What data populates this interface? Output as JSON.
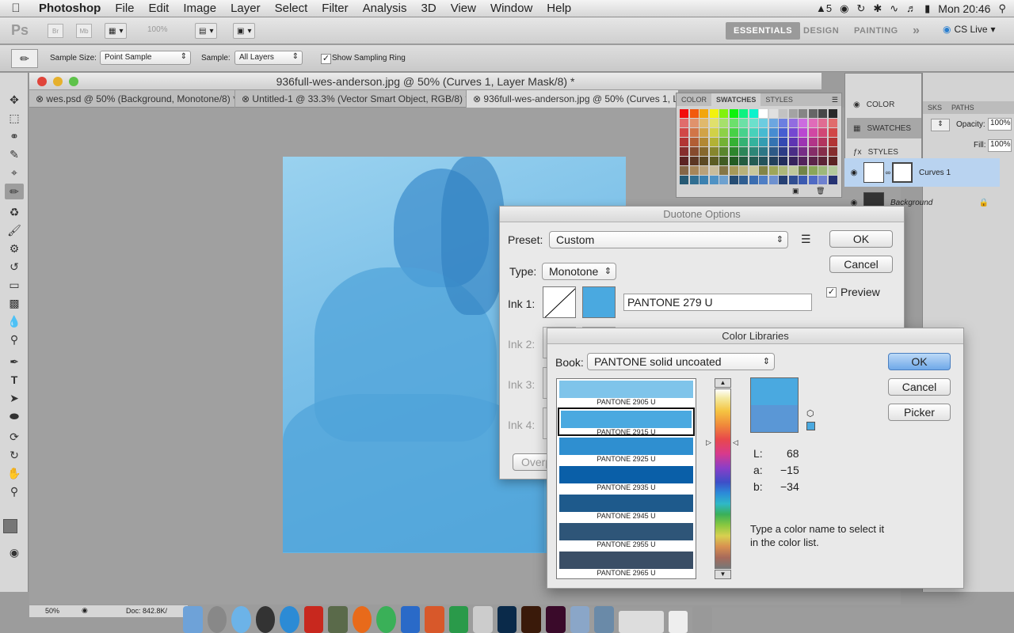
{
  "menubar": {
    "app_name": "Photoshop",
    "items": [
      "File",
      "Edit",
      "Image",
      "Layer",
      "Select",
      "Filter",
      "Analysis",
      "3D",
      "View",
      "Window",
      "Help"
    ],
    "clock": "Mon 20:46",
    "adobe_badge": "5"
  },
  "appbar": {
    "zoom": "100%",
    "workspaces": [
      "ESSENTIALS",
      "DESIGN",
      "PAINTING"
    ],
    "more": "»",
    "cslive": "CS Live"
  },
  "options": {
    "sample_size_label": "Sample Size:",
    "sample_size_value": "Point Sample",
    "sample_label": "Sample:",
    "sample_value": "All Layers",
    "ring_label": "Show Sampling Ring"
  },
  "document": {
    "title": "936full-wes-anderson.jpg @ 50% (Curves 1, Layer Mask/8) *",
    "tabs": [
      "wes.psd @ 50% (Background, Monotone/8) *",
      "Untitled-1 @ 33.3% (Vector Smart Object, RGB/8) *",
      "936full-wes-anderson.jpg @ 50% (Curves 1, L"
    ],
    "zoom": "50%",
    "doc_size": "Doc: 842.8K/"
  },
  "swatches_panel": {
    "tabs": [
      "COLOR",
      "SWATCHES",
      "STYLES"
    ]
  },
  "dock": {
    "items": [
      "COLOR",
      "SWATCHES",
      "STYLES"
    ]
  },
  "layers_panel": {
    "tabs": [
      "SKS",
      "PATHS"
    ],
    "opacity_label": "Opacity:",
    "opacity_value": "100%",
    "fill_label": "Fill:",
    "fill_value": "100%",
    "layers": [
      "Curves 1",
      "Background"
    ]
  },
  "duotone": {
    "title": "Duotone Options",
    "preset_label": "Preset:",
    "preset_value": "Custom",
    "type_label": "Type:",
    "type_value": "Monotone",
    "ink1_label": "Ink 1:",
    "ink1_name": "PANTONE 279 U",
    "ink1_color": "#4aa9e0",
    "ink2_label": "Ink 2:",
    "ink3_label": "Ink 3:",
    "ink4_label": "Ink 4:",
    "overprint_label": "Overp",
    "ok": "OK",
    "cancel": "Cancel",
    "preview_label": "Preview"
  },
  "color_libraries": {
    "title": "Color Libraries",
    "book_label": "Book:",
    "book_value": "PANTONE solid uncoated",
    "colors": [
      {
        "name": "PANTONE 2905 U",
        "hex": "#7fc4ea"
      },
      {
        "name": "PANTONE 2915 U",
        "hex": "#4aa9e0"
      },
      {
        "name": "PANTONE 2925 U",
        "hex": "#2f8fd0"
      },
      {
        "name": "PANTONE 2935 U",
        "hex": "#0a5fa8"
      },
      {
        "name": "PANTONE 2945 U",
        "hex": "#1e5a8c"
      },
      {
        "name": "PANTONE 2955 U",
        "hex": "#2e5578"
      },
      {
        "name": "PANTONE 2965 U",
        "hex": "#3a4e66"
      }
    ],
    "selected_index": 1,
    "new_color": "#4aa9e0",
    "old_color": "#5a97d6",
    "lab": {
      "L_label": "L:",
      "L": "68",
      "a_label": "a:",
      "a": "−15",
      "b_label": "b:",
      "b": "−34"
    },
    "hint": "Type a color name to select it in the color list.",
    "ok": "OK",
    "cancel": "Cancel",
    "picker": "Picker"
  }
}
